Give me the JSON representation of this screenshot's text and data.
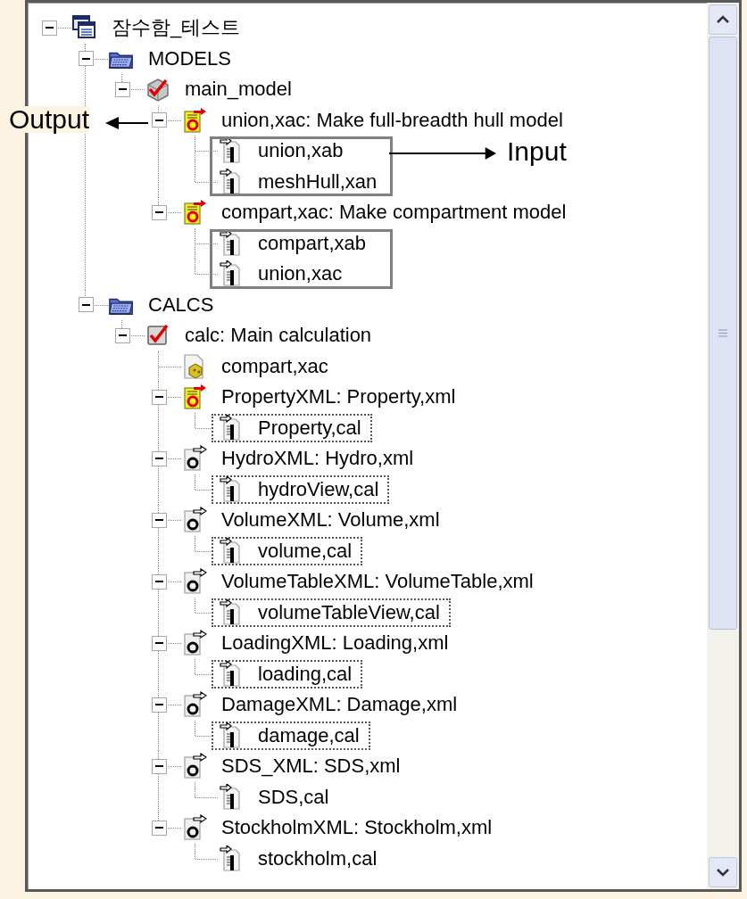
{
  "tree": {
    "label": "잠수함_테스트",
    "kind": "project",
    "expanded": true,
    "children": [
      {
        "label": "MODELS",
        "kind": "folder",
        "expanded": true,
        "children": [
          {
            "label": "main_model",
            "kind": "model",
            "expanded": true,
            "children": [
              {
                "label": "union,xac: Make full-breadth hull model",
                "kind": "output",
                "highlighted": true,
                "expanded": true,
                "inputs_framed": true,
                "children": [
                  {
                    "label": "union,xab",
                    "kind": "input",
                    "framed": false
                  },
                  {
                    "label": "meshHull,xan",
                    "kind": "input",
                    "framed": false
                  }
                ]
              },
              {
                "label": "compart,xac: Make compartment model",
                "kind": "output",
                "highlighted": true,
                "expanded": true,
                "inputs_framed": true,
                "children": [
                  {
                    "label": "compart,xab",
                    "kind": "input",
                    "framed": false
                  },
                  {
                    "label": "union,xac",
                    "kind": "input",
                    "framed": false
                  }
                ]
              }
            ]
          }
        ]
      },
      {
        "label": "CALCS",
        "kind": "folder",
        "expanded": true,
        "children": [
          {
            "label": "calc: Main calculation",
            "kind": "calc",
            "expanded": true,
            "children": [
              {
                "label": "compart,xac",
                "kind": "cube_doc"
              },
              {
                "label": "PropertyXML: Property,xml",
                "kind": "output",
                "highlighted": true,
                "expanded": true,
                "inputs_framed": false,
                "children": [
                  {
                    "label": "Property,cal",
                    "kind": "input",
                    "framed": true
                  }
                ]
              },
              {
                "label": "HydroXML: Hydro,xml",
                "kind": "output",
                "highlighted": false,
                "expanded": true,
                "inputs_framed": false,
                "children": [
                  {
                    "label": "hydroView,cal",
                    "kind": "input",
                    "framed": true
                  }
                ]
              },
              {
                "label": "VolumeXML: Volume,xml",
                "kind": "output",
                "highlighted": false,
                "expanded": true,
                "inputs_framed": false,
                "children": [
                  {
                    "label": "volume,cal",
                    "kind": "input",
                    "framed": true
                  }
                ]
              },
              {
                "label": "VolumeTableXML: VolumeTable,xml",
                "kind": "output",
                "highlighted": false,
                "expanded": true,
                "inputs_framed": false,
                "children": [
                  {
                    "label": "volumeTableView,cal",
                    "kind": "input",
                    "framed": true
                  }
                ]
              },
              {
                "label": "LoadingXML: Loading,xml",
                "kind": "output",
                "highlighted": false,
                "expanded": true,
                "inputs_framed": false,
                "children": [
                  {
                    "label": "loading,cal",
                    "kind": "input",
                    "framed": true
                  }
                ]
              },
              {
                "label": "DamageXML: Damage,xml",
                "kind": "output",
                "highlighted": false,
                "expanded": true,
                "inputs_framed": false,
                "children": [
                  {
                    "label": "damage,cal",
                    "kind": "input",
                    "framed": true
                  }
                ]
              },
              {
                "label": "SDS_XML: SDS,xml",
                "kind": "output",
                "highlighted": false,
                "expanded": true,
                "inputs_framed": false,
                "children": [
                  {
                    "label": "SDS,cal",
                    "kind": "input",
                    "framed": false
                  }
                ]
              },
              {
                "label": "StockholmXML: Stockholm,xml",
                "kind": "output",
                "highlighted": false,
                "expanded": true,
                "inputs_framed": false,
                "children": [
                  {
                    "label": "stockholm,cal",
                    "kind": "input",
                    "framed": false
                  }
                ]
              }
            ]
          }
        ]
      }
    ]
  },
  "annotations": [
    {
      "kind": "output",
      "label": "Output"
    },
    {
      "kind": "input",
      "label": "Input"
    }
  ]
}
